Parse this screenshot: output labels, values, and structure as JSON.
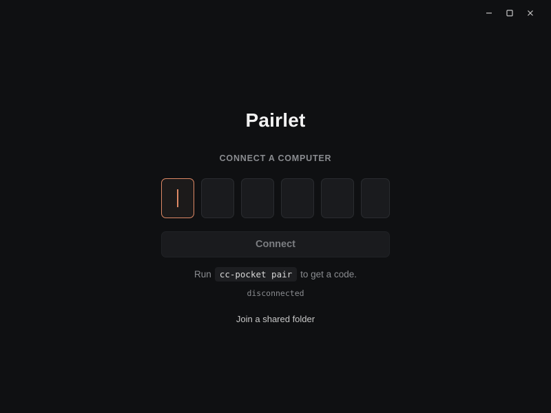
{
  "window": {
    "controls": [
      {
        "name": "minimize",
        "icon": "minimize-icon"
      },
      {
        "name": "maximize",
        "icon": "maximize-icon"
      },
      {
        "name": "close",
        "icon": "close-icon"
      }
    ]
  },
  "app": {
    "title": "Pairlet"
  },
  "pairing": {
    "section_label": "CONNECT A COMPUTER",
    "code_cells": [
      "",
      "",
      "",
      "",
      "",
      ""
    ],
    "active_cell_index": 0,
    "connect_label": "Connect",
    "hint_prefix": "Run",
    "hint_command": "cc-pocket pair",
    "hint_suffix": "to get a code.",
    "status": "disconnected",
    "join_label": "Join a shared folder"
  },
  "colors": {
    "background": "#0f1012",
    "accent": "#e08a66",
    "muted_text": "#8a8c90"
  }
}
